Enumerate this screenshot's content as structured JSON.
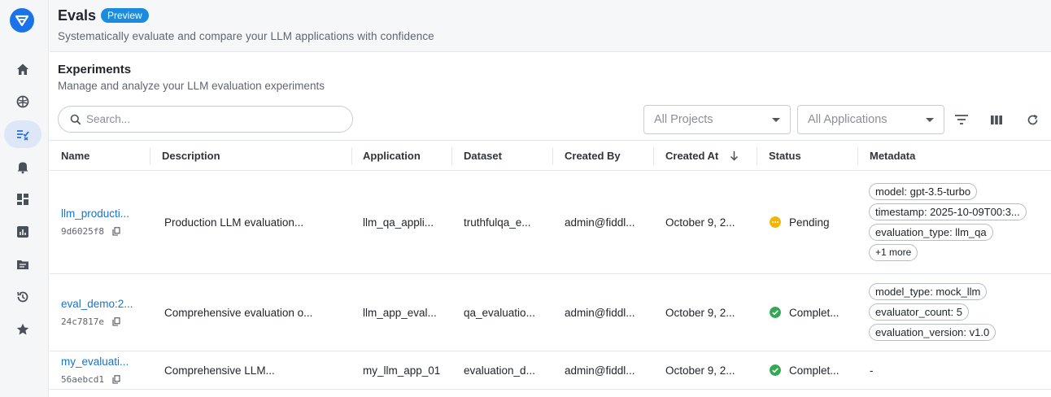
{
  "header": {
    "title": "Evals",
    "badge": "Preview",
    "subtitle": "Systematically evaluate and compare your LLM applications with confidence"
  },
  "section": {
    "title": "Experiments",
    "subtitle": "Manage and analyze your LLM evaluation experiments"
  },
  "toolbar": {
    "search_placeholder": "Search...",
    "projects_select": "All Projects",
    "applications_select": "All Applications"
  },
  "sidebar": {
    "items": [
      {
        "icon": "home-icon"
      },
      {
        "icon": "brain-icon"
      },
      {
        "icon": "evals-icon",
        "active": true
      },
      {
        "icon": "bell-icon"
      },
      {
        "icon": "dashboard-icon"
      },
      {
        "icon": "chart-icon"
      },
      {
        "icon": "folder-icon"
      },
      {
        "icon": "history-icon"
      },
      {
        "icon": "star-icon"
      }
    ]
  },
  "table": {
    "columns": [
      "Name",
      "Description",
      "Application",
      "Dataset",
      "Created By",
      "Created At",
      "Status",
      "Metadata"
    ],
    "rows": [
      {
        "name": "llm_producti...",
        "id": "9d6025f8",
        "description": "Production LLM evaluation...",
        "application": "llm_qa_appli...",
        "dataset": "truthfulqa_e...",
        "created_by": "admin@fiddl...",
        "created_at": "October 9, 2...",
        "status": "Pending",
        "metadata": [
          "model: gpt-3.5-turbo",
          "timestamp: 2025-10-09T00:3...",
          "evaluation_type: llm_qa",
          "+1 more"
        ]
      },
      {
        "name": "eval_demo:2...",
        "id": "24c7817e",
        "description": "Comprehensive evaluation o...",
        "application": "llm_app_eval...",
        "dataset": "qa_evaluatio...",
        "created_by": "admin@fiddl...",
        "created_at": "October 9, 2...",
        "status": "Complet...",
        "metadata": [
          "model_type: mock_llm",
          "evaluator_count: 5",
          "evaluation_version: v1.0"
        ]
      },
      {
        "name": "my_evaluati...",
        "id": "56aebcd1",
        "description": "Comprehensive LLM...",
        "application": "my_llm_app_01",
        "dataset": "evaluation_d...",
        "created_by": "admin@fiddl...",
        "created_at": "October 9, 2...",
        "status": "Complet...",
        "metadata_empty": "-"
      }
    ]
  },
  "colors": {
    "accent": "#1a73e8",
    "badge": "#1c8bdd",
    "pending": "#f4b400",
    "complete": "#34a853"
  }
}
